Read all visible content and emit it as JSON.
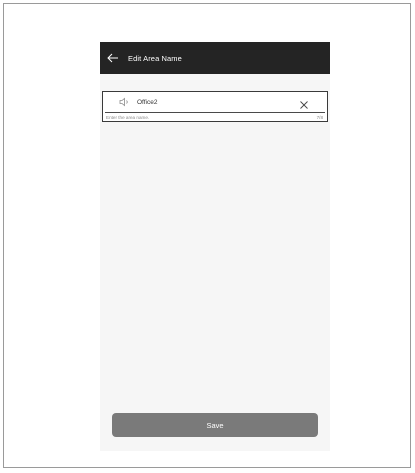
{
  "appbar": {
    "title": "Edit Area Name",
    "back_icon": "arrow-left-icon"
  },
  "name_field": {
    "icon": "speaker-icon",
    "value": "Office2",
    "placeholder": "",
    "clear_icon": "close-icon",
    "hint": "Enter the area name.",
    "counter": "7/8"
  },
  "footer": {
    "save_label": "Save"
  },
  "colors": {
    "appbar": "#242424",
    "screen_background": "#f6f6f6",
    "save_button": "#7a7a7a"
  }
}
